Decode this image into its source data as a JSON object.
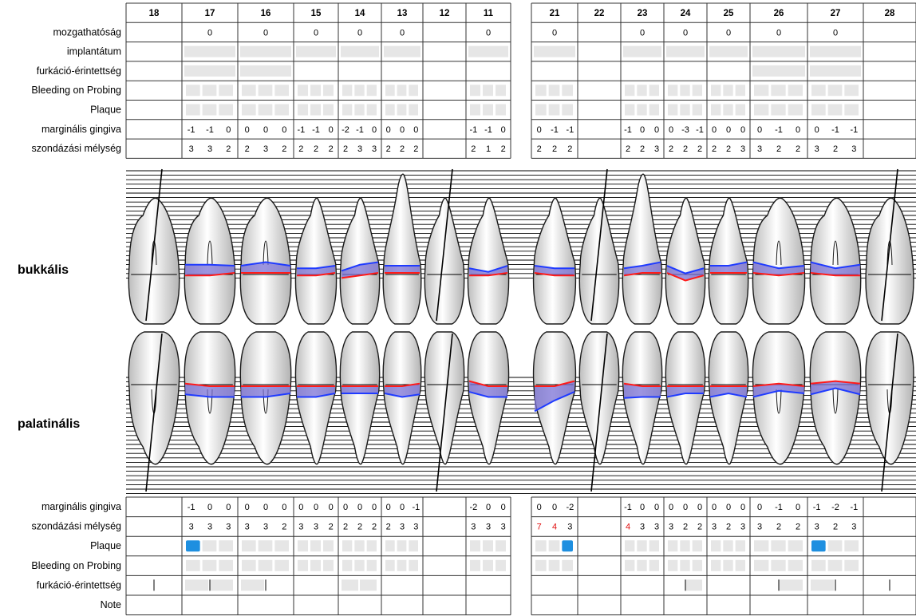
{
  "upper_teeth": [
    "18",
    "17",
    "16",
    "15",
    "14",
    "13",
    "12",
    "11",
    "21",
    "22",
    "23",
    "24",
    "25",
    "26",
    "27",
    "28"
  ],
  "upper_rows": [
    "mozgathatóság",
    "implantátum",
    "furkáció-érintettség",
    "Bleeding on Probing",
    "Plaque",
    "marginális gingiva",
    "szondázási mélység"
  ],
  "lower_rows": [
    "marginális gingiva",
    "szondázási mélység",
    "Plaque",
    "Bleeding on Probing",
    "furkáció-érintettség",
    "Note"
  ],
  "side_labels": {
    "buccal": "bukkális",
    "palatal": "palatinális"
  },
  "present": [
    false,
    true,
    true,
    true,
    true,
    true,
    false,
    true,
    true,
    false,
    true,
    true,
    true,
    true,
    true,
    false
  ],
  "mobility": [
    "",
    "0",
    "0",
    "0",
    "0",
    "0",
    "",
    "0",
    "0",
    "",
    "0",
    "0",
    "0",
    "0",
    "0",
    ""
  ],
  "implant_boxes": [
    0,
    1,
    1,
    1,
    1,
    1,
    0,
    1,
    1,
    0,
    1,
    1,
    1,
    1,
    1,
    0
  ],
  "upper_furcation_boxes": [
    0,
    1,
    1,
    0,
    0,
    0,
    0,
    0,
    0,
    0,
    0,
    0,
    0,
    1,
    1,
    0
  ],
  "buccal_margin": [
    null,
    [
      "-1",
      "-1",
      "0"
    ],
    [
      "0",
      "0",
      "0"
    ],
    [
      "-1",
      "-1",
      "0"
    ],
    [
      "-2",
      "-1",
      "0"
    ],
    [
      "0",
      "0",
      "0"
    ],
    null,
    [
      "-1",
      "-1",
      "0"
    ],
    [
      "0",
      "-1",
      "-1"
    ],
    null,
    [
      "-1",
      "0",
      "0"
    ],
    [
      "0",
      "-3",
      "-1"
    ],
    [
      "0",
      "0",
      "0"
    ],
    [
      "0",
      "-1",
      "0"
    ],
    [
      "0",
      "-1",
      "-1"
    ],
    null
  ],
  "buccal_depth": [
    null,
    [
      "3",
      "3",
      "2"
    ],
    [
      "2",
      "3",
      "2"
    ],
    [
      "2",
      "2",
      "2"
    ],
    [
      "2",
      "3",
      "3"
    ],
    [
      "2",
      "2",
      "2"
    ],
    null,
    [
      "2",
      "1",
      "2"
    ],
    [
      "2",
      "2",
      "2"
    ],
    null,
    [
      "2",
      "2",
      "3"
    ],
    [
      "2",
      "2",
      "2"
    ],
    [
      "2",
      "2",
      "3"
    ],
    [
      "3",
      "2",
      "2"
    ],
    [
      "3",
      "2",
      "3"
    ],
    null
  ],
  "palatal_margin": [
    null,
    [
      "-1",
      "0",
      "0"
    ],
    [
      "0",
      "0",
      "0"
    ],
    [
      "0",
      "0",
      "0"
    ],
    [
      "0",
      "0",
      "0"
    ],
    [
      "0",
      "0",
      "-1"
    ],
    null,
    [
      "-2",
      "0",
      "0"
    ],
    [
      "0",
      "0",
      "-2"
    ],
    null,
    [
      "-1",
      "0",
      "0"
    ],
    [
      "0",
      "0",
      "0"
    ],
    [
      "0",
      "0",
      "0"
    ],
    [
      "0",
      "-1",
      "0"
    ],
    [
      "-1",
      "-2",
      "-1"
    ],
    null
  ],
  "palatal_depth": [
    null,
    [
      "3",
      "3",
      "3"
    ],
    [
      "3",
      "3",
      "2"
    ],
    [
      "3",
      "3",
      "2"
    ],
    [
      "2",
      "2",
      "2"
    ],
    [
      "2",
      "3",
      "3"
    ],
    null,
    [
      "3",
      "3",
      "3"
    ],
    [
      "7",
      "4",
      "3"
    ],
    null,
    [
      "4",
      "3",
      "3"
    ],
    [
      "3",
      "2",
      "2"
    ],
    [
      "3",
      "2",
      "3"
    ],
    [
      "3",
      "2",
      "2"
    ],
    [
      "3",
      "2",
      "3"
    ],
    null
  ],
  "red_depth_marks": [
    "21-0",
    "21-1",
    "23-0"
  ],
  "plaque_marks": [
    "17-0",
    "21-2",
    "27-0"
  ],
  "lower_furcation": {
    "boxes": [
      "17-0",
      "17-1",
      "16-0",
      "14-0",
      "14-1",
      "24-1",
      "26-1",
      "27-0"
    ],
    "ticks": [
      "18-1",
      "17-1",
      "16-1",
      "24-1",
      "26-1",
      "27-1",
      "28-1"
    ]
  },
  "colors": {
    "pocket_fill": "#7b72d6",
    "pocket_line": "#1f3bff",
    "gingiva_line": "#ff1a1a",
    "marked_plaque": "#1e8fe0",
    "inactive_box": "#e6e6e6",
    "red_text": "#e01010",
    "tooth_stroke": "#1a1a1a"
  }
}
